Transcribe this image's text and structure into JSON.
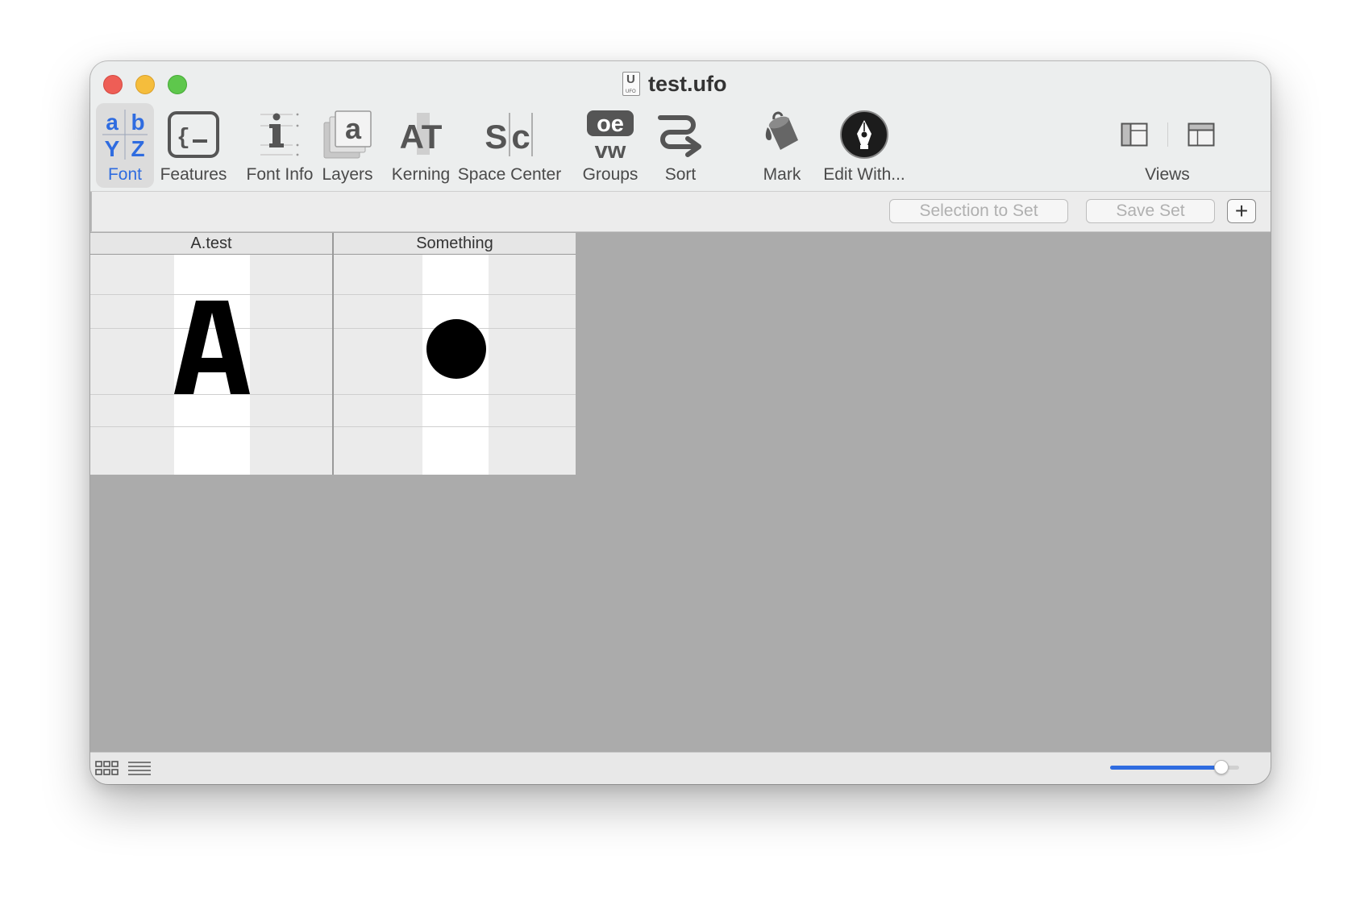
{
  "window": {
    "title": "test.ufo",
    "doc_icon_letter": "U",
    "doc_icon_caption": "UFO"
  },
  "toolbar": {
    "items": [
      {
        "label": "Font",
        "icon": "font-icon",
        "active": true
      },
      {
        "label": "Features",
        "icon": "features-icon"
      },
      {
        "label": "Font Info",
        "icon": "font-info-icon"
      },
      {
        "label": "Layers",
        "icon": "layers-icon"
      },
      {
        "label": "Kerning",
        "icon": "kerning-icon"
      },
      {
        "label": "Space Center",
        "icon": "space-center-icon"
      },
      {
        "label": "Groups",
        "icon": "groups-icon"
      },
      {
        "label": "Sort",
        "icon": "sort-icon"
      },
      {
        "label": "Mark",
        "icon": "mark-icon"
      },
      {
        "label": "Edit With...",
        "icon": "edit-with-icon"
      },
      {
        "label": "Views",
        "icon": "views-icon"
      }
    ],
    "font_icon_letters": [
      "a",
      "b",
      "Y",
      "Z"
    ],
    "kerning_icon_text": "AT",
    "space_center_icon_text": "Sc",
    "groups_icon_top": "oe",
    "groups_icon_bottom": "vw",
    "layers_icon_text": "a",
    "accent_color": "#2f6ce0"
  },
  "setbar": {
    "selection_to_set": "Selection to Set",
    "save_set": "Save Set",
    "add_label": "+"
  },
  "glyphs": [
    {
      "name": "A.test",
      "glyph": "A"
    },
    {
      "name": "Something",
      "glyph": "dot"
    }
  ],
  "bottombar": {
    "cell_size_slider_value": 0.86
  }
}
